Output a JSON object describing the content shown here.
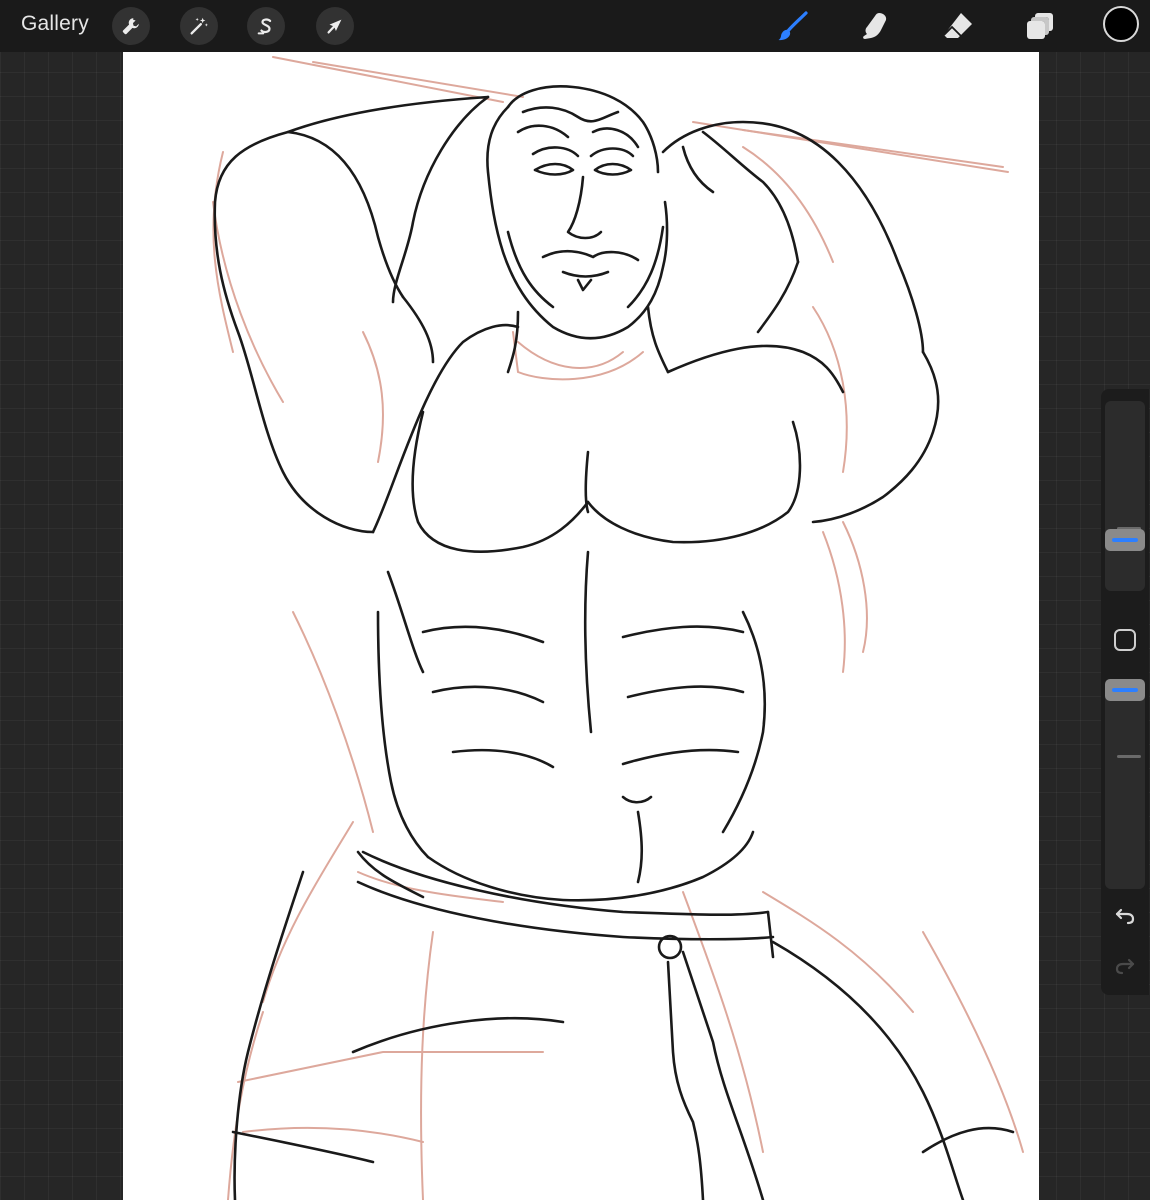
{
  "app": {
    "gallery_label": "Gallery"
  },
  "toolbar_left": [
    {
      "name": "actions",
      "icon": "wrench-icon"
    },
    {
      "name": "adjustments",
      "icon": "magic-wand-icon"
    },
    {
      "name": "selection",
      "icon": "selection-s-icon"
    },
    {
      "name": "transform",
      "icon": "arrow-cursor-icon"
    }
  ],
  "toolbar_right": [
    {
      "name": "brush",
      "icon": "brush-icon",
      "active": true
    },
    {
      "name": "smudge",
      "icon": "smudge-finger-icon",
      "active": false
    },
    {
      "name": "eraser",
      "icon": "eraser-icon",
      "active": false
    },
    {
      "name": "layers",
      "icon": "layers-icon",
      "active": false
    }
  ],
  "colors": {
    "accent": "#2c7fff",
    "current_color": "#000000",
    "canvas": "#ffffff",
    "sketch_red": "#d9a093",
    "ink": "#1a1a1a"
  },
  "sidebar": {
    "brush_size_level": 0.24,
    "opacity_level": 0.22,
    "modify_icon": "square-icon",
    "undo_icon": "undo-icon",
    "redo_icon": "redo-icon"
  },
  "canvas_content": {
    "icon": "line-art-illustration"
  }
}
